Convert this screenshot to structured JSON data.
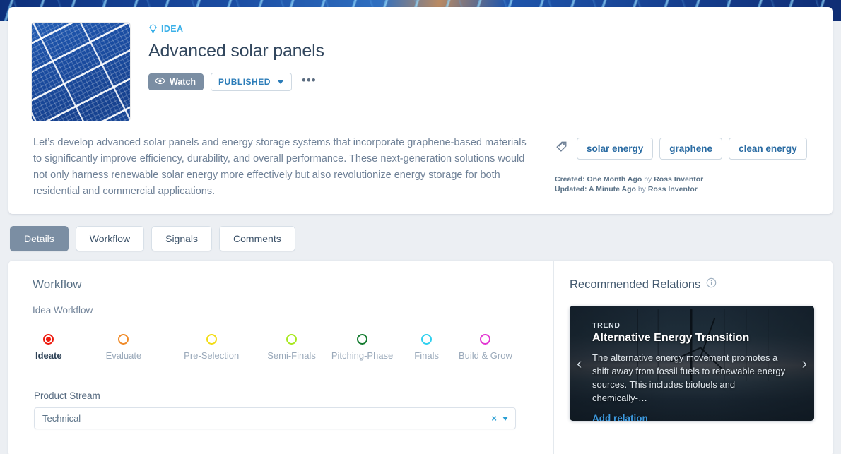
{
  "banner": {
    "alt": "solar-panel-banner"
  },
  "header": {
    "thumbnail_alt": "solar-panel-thumbnail",
    "kind_label": "IDEA",
    "kind_icon": "lightbulb-icon",
    "title": "Advanced solar panels",
    "watch_label": "Watch",
    "watch_icon": "eye-icon",
    "status_label": "PUBLISHED",
    "more_label": "•••",
    "description": "Let’s develop advanced solar panels and energy storage systems that incorporate graphene-based materials to significantly improve efficiency, durability, and overall performance. These next-generation solutions would not only harness renewable solar energy more effectively but also revolutionize energy storage for both residential and commercial applications.",
    "tags_icon": "tag-icon",
    "tags": [
      "solar energy",
      "graphene",
      "clean energy"
    ],
    "created_label": "Created: One Month Ago",
    "created_by_word": "by",
    "created_by": "Ross Inventor",
    "updated_label": "Updated: A Minute Ago",
    "updated_by_word": "by",
    "updated_by": "Ross Inventor"
  },
  "tabs": [
    {
      "label": "Details",
      "active": true
    },
    {
      "label": "Workflow",
      "active": false
    },
    {
      "label": "Signals",
      "active": false
    },
    {
      "label": "Comments",
      "active": false
    }
  ],
  "workflow": {
    "title": "Workflow",
    "subtitle": "Idea Workflow",
    "steps": [
      {
        "label": "Ideate",
        "color": "#ee1b0f",
        "current": true
      },
      {
        "label": "Evaluate",
        "color": "#f08a28",
        "current": false
      },
      {
        "label": "Pre-Selection",
        "color": "#f2dc16",
        "current": false
      },
      {
        "label": "Semi-Finals",
        "color": "#a8e821",
        "current": false
      },
      {
        "label": "Pitching-Phase",
        "color": "#127a2e",
        "current": false
      },
      {
        "label": "Finals",
        "color": "#2fd0ef",
        "current": false
      },
      {
        "label": "Build & Grow",
        "color": "#e234d1",
        "current": false
      }
    ],
    "field_label": "Product Stream",
    "field_value": "Technical",
    "field_clear": "×"
  },
  "relations": {
    "title": "Recommended Relations",
    "info_icon": "info-icon",
    "prev_icon": "chevron-left-icon",
    "next_icon": "chevron-right-icon",
    "card": {
      "kicker": "TREND",
      "name": "Alternative Energy Transition",
      "description": "The alternative energy movement promotes a shift away from fossil fuels to renewable energy sources. This includes biofuels and chemically-…",
      "link_label": "Add relation",
      "background_alt": "offshore-wind-farm-photo"
    }
  },
  "colors": {
    "page_background": "#eceff3",
    "accent_blue": "#2b7cb8",
    "link_blue": "#3d9ae0",
    "muted_text": "#6f8197",
    "active_tab": "#7b8ea3"
  }
}
